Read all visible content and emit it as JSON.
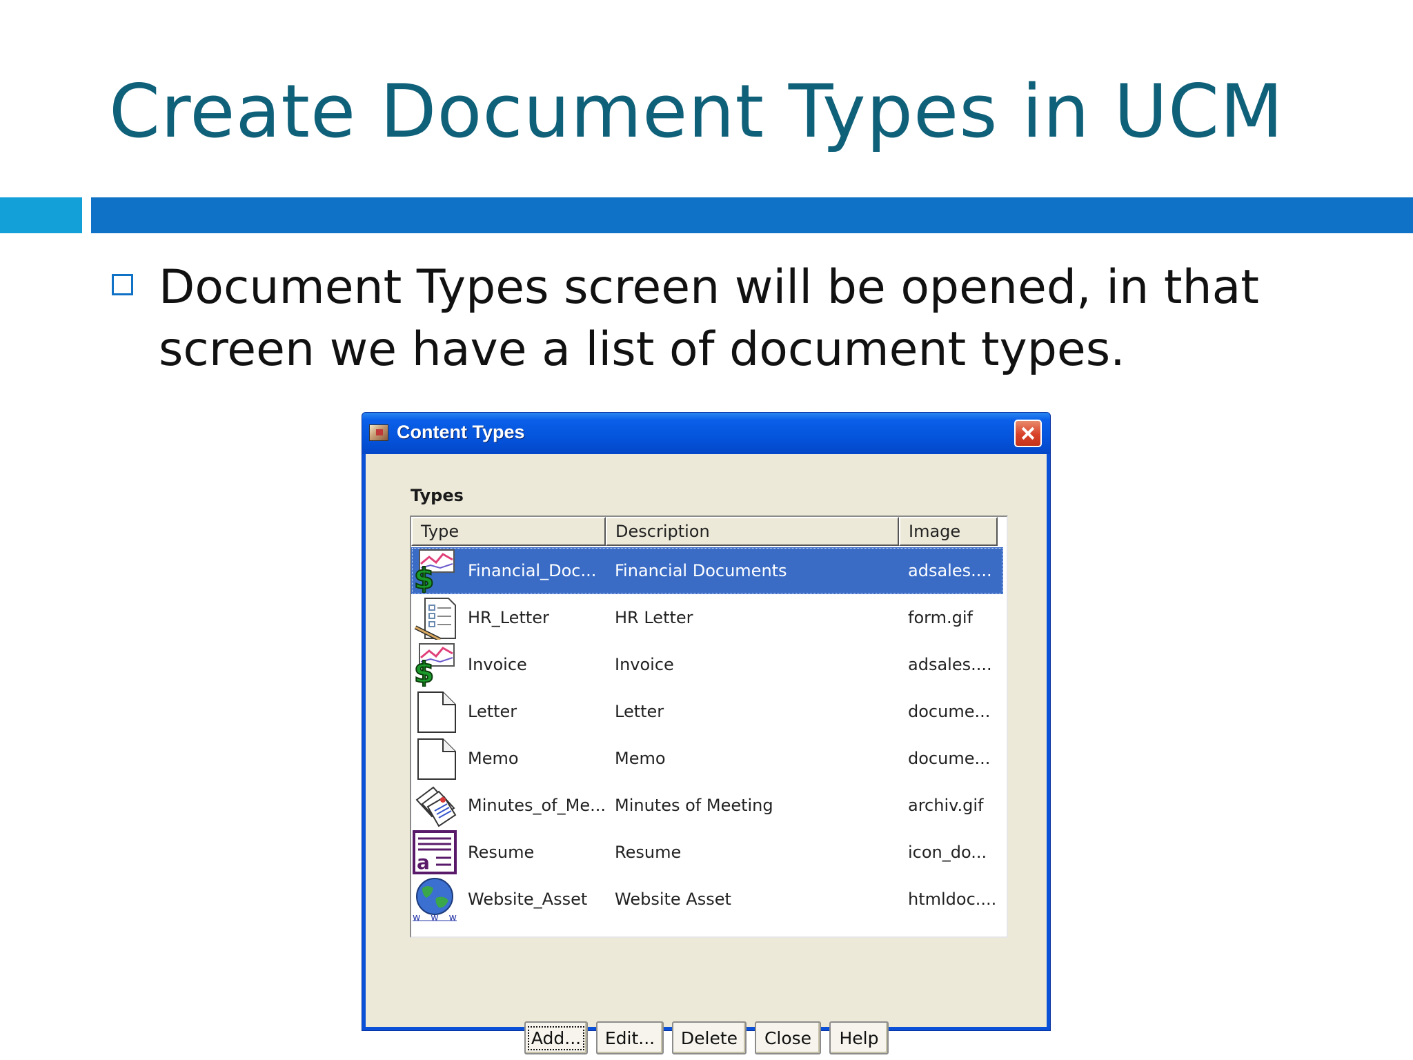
{
  "slide": {
    "title": "Create Document Types in UCM",
    "bullet": "Document Types screen will be opened, in that screen we have a list of document types."
  },
  "dialog": {
    "title": "Content Types",
    "section_label": "Types",
    "columns": [
      "Type",
      "Description",
      "Image"
    ],
    "rows": [
      {
        "type": "Financial_Doc...",
        "description": "Financial Documents",
        "image": "adsales....",
        "icon": "financial-chart-dollar-icon",
        "selected": true
      },
      {
        "type": "HR_Letter",
        "description": "HR Letter",
        "image": "form.gif",
        "icon": "form-pen-icon",
        "selected": false
      },
      {
        "type": "Invoice",
        "description": "Invoice",
        "image": "adsales....",
        "icon": "financial-chart-dollar-icon",
        "selected": false
      },
      {
        "type": "Letter",
        "description": "Letter",
        "image": "docume...",
        "icon": "blank-document-icon",
        "selected": false
      },
      {
        "type": "Memo",
        "description": "Memo",
        "image": "docume...",
        "icon": "blank-document-icon",
        "selected": false
      },
      {
        "type": "Minutes_of_Me...",
        "description": "Minutes of Meeting",
        "image": "archiv.gif",
        "icon": "stacked-papers-icon",
        "selected": false
      },
      {
        "type": "Resume",
        "description": "Resume",
        "image": "icon_do...",
        "icon": "resume-document-icon",
        "selected": false
      },
      {
        "type": "Website_Asset",
        "description": "Website Asset",
        "image": "htmldoc....",
        "icon": "globe-www-icon",
        "selected": false
      }
    ],
    "buttons": {
      "add": "Add...",
      "edit": "Edit...",
      "delete": "Delete",
      "close": "Close",
      "help": "Help"
    }
  },
  "colors": {
    "title_text": "#0f6079",
    "accent_bar": "#1072c6",
    "accent_bar_left": "#139fd8",
    "titlebar": "#0554dc",
    "selection": "#3a6cc6",
    "dialog_face": "#ece9d8"
  }
}
